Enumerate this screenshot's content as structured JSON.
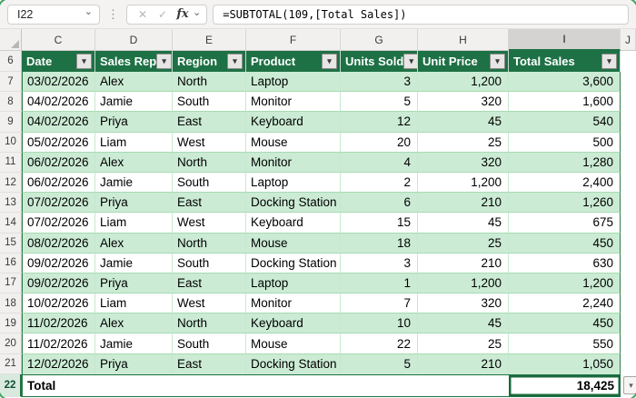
{
  "formula_bar": {
    "name_box": "I22",
    "formula": "=SUBTOTAL(109,[Total Sales])"
  },
  "icons": {
    "cancel": "✕",
    "enter": "✓",
    "fx": "fx",
    "chevron_down": "⌄",
    "kebab_dots": "⋮",
    "filter": "▾",
    "dropdown": "▾"
  },
  "grid": {
    "column_letters": [
      "C",
      "D",
      "E",
      "F",
      "G",
      "H",
      "I",
      "J"
    ],
    "selected_column_letter": "I",
    "row_numbers": [
      "6",
      "7",
      "8",
      "9",
      "10",
      "11",
      "12",
      "13",
      "14",
      "15",
      "16",
      "17",
      "18",
      "19",
      "20",
      "21",
      "22"
    ],
    "selected_row_number": "22"
  },
  "table": {
    "headers": [
      "Date",
      "Sales Rep",
      "Region",
      "Product",
      "Units Sold",
      "Unit Price",
      "Total Sales"
    ],
    "rows": [
      [
        "03/02/2026",
        "Alex",
        "North",
        "Laptop",
        "3",
        "1,200",
        "3,600"
      ],
      [
        "04/02/2026",
        "Jamie",
        "South",
        "Monitor",
        "5",
        "320",
        "1,600"
      ],
      [
        "04/02/2026",
        "Priya",
        "East",
        "Keyboard",
        "12",
        "45",
        "540"
      ],
      [
        "05/02/2026",
        "Liam",
        "West",
        "Mouse",
        "20",
        "25",
        "500"
      ],
      [
        "06/02/2026",
        "Alex",
        "North",
        "Monitor",
        "4",
        "320",
        "1,280"
      ],
      [
        "06/02/2026",
        "Jamie",
        "South",
        "Laptop",
        "2",
        "1,200",
        "2,400"
      ],
      [
        "07/02/2026",
        "Priya",
        "East",
        "Docking Station",
        "6",
        "210",
        "1,260"
      ],
      [
        "07/02/2026",
        "Liam",
        "West",
        "Keyboard",
        "15",
        "45",
        "675"
      ],
      [
        "08/02/2026",
        "Alex",
        "North",
        "Mouse",
        "18",
        "25",
        "450"
      ],
      [
        "09/02/2026",
        "Jamie",
        "South",
        "Docking Station",
        "3",
        "210",
        "630"
      ],
      [
        "09/02/2026",
        "Priya",
        "East",
        "Laptop",
        "1",
        "1,200",
        "1,200"
      ],
      [
        "10/02/2026",
        "Liam",
        "West",
        "Monitor",
        "7",
        "320",
        "2,240"
      ],
      [
        "11/02/2026",
        "Alex",
        "North",
        "Keyboard",
        "10",
        "45",
        "450"
      ],
      [
        "11/02/2026",
        "Jamie",
        "South",
        "Mouse",
        "22",
        "25",
        "550"
      ],
      [
        "12/02/2026",
        "Priya",
        "East",
        "Docking Station",
        "5",
        "210",
        "1,050"
      ]
    ],
    "total": {
      "label": "Total",
      "value": "18,425"
    }
  },
  "colors": {
    "header_green": "#1E7145",
    "band_green": "#CBEBD4",
    "selection_green": "#1A6B3C",
    "frame_green": "#3FA45C",
    "gridline_green": "#A7DBB1"
  }
}
